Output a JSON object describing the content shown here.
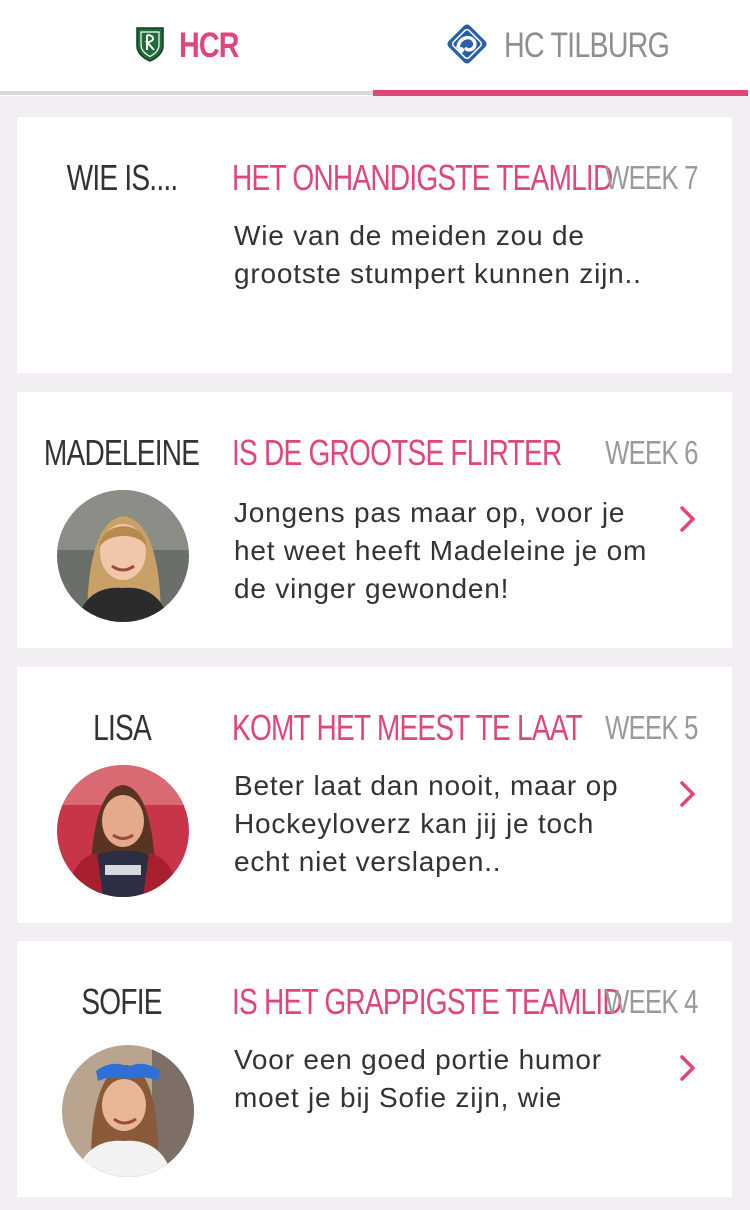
{
  "tabs": [
    {
      "label": "HCR",
      "icon": "shield-logo-icon",
      "active": false
    },
    {
      "label": "HC TILBURG",
      "icon": "club-logo-icon",
      "active": true
    }
  ],
  "colors": {
    "accent": "#e0457e",
    "muted": "#9a9a9a",
    "background": "#f3eef3"
  },
  "cards": [
    {
      "name": "WIE IS....",
      "title": "HET ONHANDIGSTE TEAMLID",
      "week": "WEEK 7",
      "text": "Wie van de meiden zou de grootste stumpert kunnen zijn.."
    },
    {
      "name": "MADELEINE",
      "title": "IS DE GROOTSE FLIRTER",
      "week": "WEEK 6",
      "text": "Jongens pas maar op, voor je het weet heeft Madeleine je om de vinger gewonden!",
      "chevron": "chevron-right-icon"
    },
    {
      "name": "LISA",
      "title": "KOMT HET MEEST TE LAAT",
      "week": "WEEK 5",
      "text": "Beter laat dan nooit, maar op Hockeyloverz kan jij je toch echt niet verslapen..",
      "chevron": "chevron-right-icon"
    },
    {
      "name": "SOFIE",
      "title": "IS HET GRAPPIGSTE TEAMLID",
      "week": "WEEK 4",
      "text": "Voor een goed portie humor moet je bij Sofie zijn, wie",
      "chevron": "chevron-right-icon"
    }
  ]
}
